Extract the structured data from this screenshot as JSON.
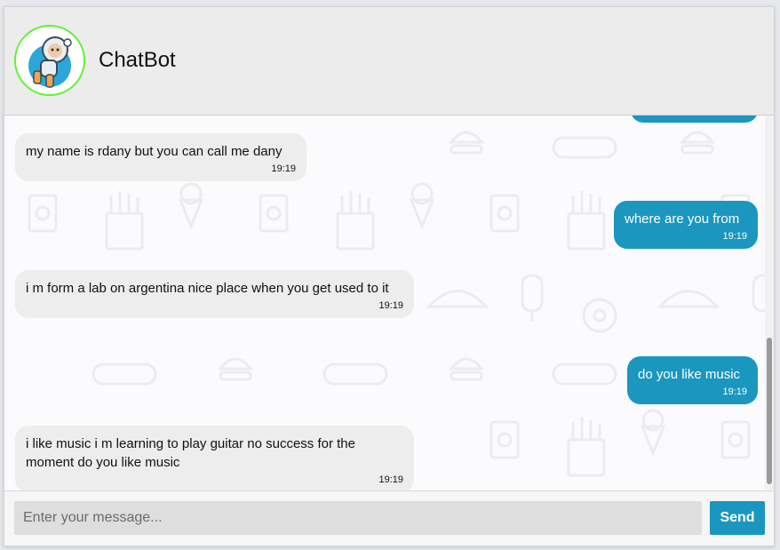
{
  "header": {
    "bot_name": "ChatBot",
    "avatar_icon": "astronaut-avatar-icon"
  },
  "messages": [
    {
      "sender": "bot",
      "text": "my name is rdany but you can call me dany",
      "time": "19:19"
    },
    {
      "sender": "user",
      "text": "where are you from",
      "time": "19:19"
    },
    {
      "sender": "bot",
      "text": "i m form a lab on argentina nice place when you get used to it",
      "time": "19:19"
    },
    {
      "sender": "user",
      "text": "do you like music",
      "time": "19:19"
    },
    {
      "sender": "bot",
      "text": "i like music i m learning to play guitar no success for the moment do you like music",
      "time": "19:19"
    }
  ],
  "input": {
    "placeholder": "Enter your message...",
    "value": ""
  },
  "send_button": {
    "label": "Send"
  },
  "colors": {
    "accent": "#1b96bf",
    "bot_bubble": "#ededed",
    "avatar_ring": "#5ff233",
    "header_bg": "#ececec"
  }
}
